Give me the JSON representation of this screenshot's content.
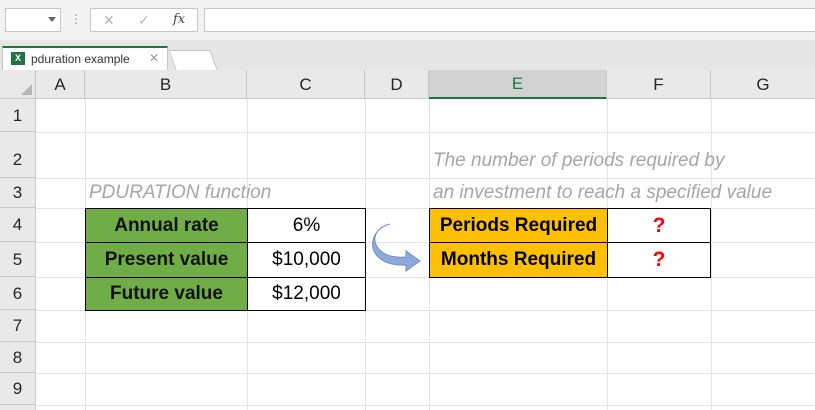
{
  "formula_bar": {
    "name_box": "",
    "dots": "⋮",
    "cancel_icon": "✕",
    "enter_icon": "✓",
    "fx_label": "fx",
    "formula": ""
  },
  "tabs": {
    "file_icon_letter": "X",
    "file_name": "pduration example",
    "close_icon": "✕"
  },
  "columns": [
    "A",
    "B",
    "C",
    "D",
    "E",
    "F",
    "G"
  ],
  "rows": [
    "1",
    "2",
    "3",
    "4",
    "5",
    "6",
    "7",
    "8",
    "9"
  ],
  "sheet": {
    "subtitle": "PDURATION function",
    "description_line1": "The number of periods required by",
    "description_line2": "an investment to reach a specified value",
    "inputs": [
      {
        "label": "Annual rate",
        "value": "6%"
      },
      {
        "label": "Present value",
        "value": "$10,000"
      },
      {
        "label": "Future value",
        "value": "$12,000"
      }
    ],
    "outputs": [
      {
        "label": "Periods Required",
        "value": "?"
      },
      {
        "label": "Months Required",
        "value": "?"
      }
    ]
  },
  "colors": {
    "label_green": "#70ad47",
    "label_orange": "#ffc000",
    "question_red": "#ff0000",
    "excel_green": "#217346",
    "arrow_blue": "#8eaadb"
  }
}
